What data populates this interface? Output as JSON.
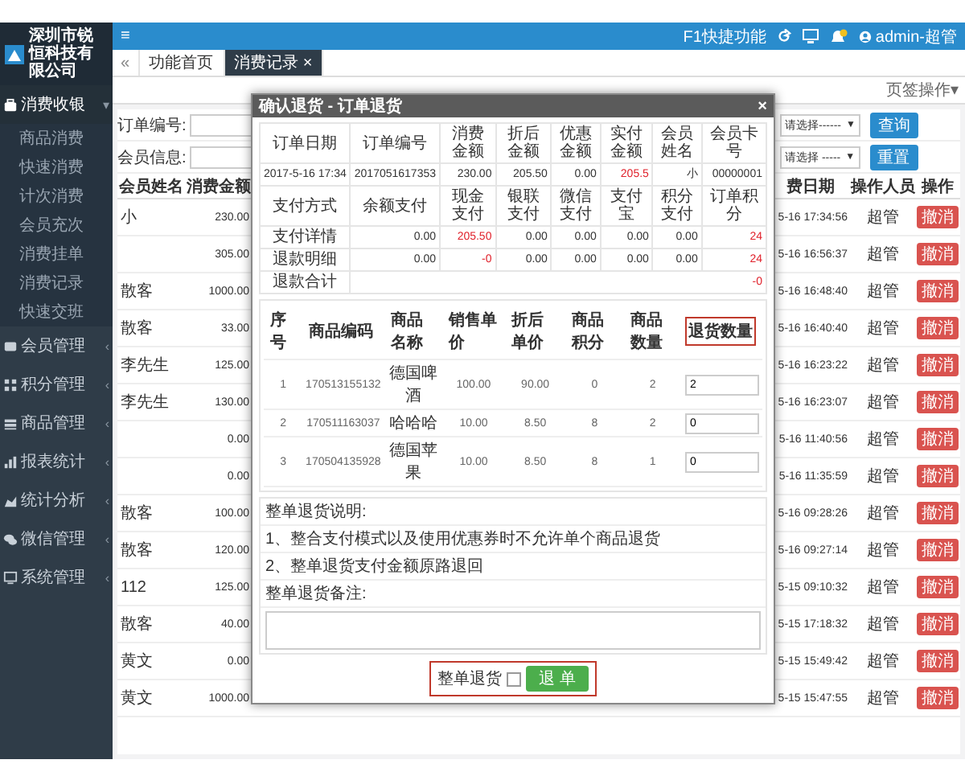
{
  "sidebar": {
    "logo": "深圳市锐恒科技有限公司",
    "menu": [
      {
        "label": "消费收银",
        "expanded": true,
        "children": [
          "商品消费",
          "快速消费",
          "计次消费",
          "会员充次",
          "消费挂单",
          "消费记录",
          "快速交班"
        ]
      },
      {
        "label": "会员管理",
        "expanded": false
      },
      {
        "label": "积分管理",
        "expanded": false
      },
      {
        "label": "商品管理",
        "expanded": false
      },
      {
        "label": "报表统计",
        "expanded": false
      },
      {
        "label": "统计分析",
        "expanded": false
      },
      {
        "label": "微信管理",
        "expanded": false
      },
      {
        "label": "系统管理",
        "expanded": false
      }
    ],
    "collapse": "‹",
    "expanded_mark": "▾"
  },
  "topbar": {
    "menu_toggle": "≡",
    "shortcut": "F1快捷功能",
    "user": "admin-超管"
  },
  "tabs": {
    "back": "«",
    "items": [
      {
        "label": "功能首页",
        "selected": false
      },
      {
        "label": "消费记录",
        "selected": true,
        "close": "×"
      }
    ]
  },
  "tab_menu": {
    "label": "页签操作",
    "caret": "▾"
  },
  "filters": [
    {
      "label": "订单编号:",
      "select": "请选择------",
      "caret": "▼",
      "button": "查询"
    },
    {
      "label": "会员信息:",
      "select": "请选择 -----",
      "caret": "▼",
      "button": "重置"
    }
  ],
  "table": {
    "columns_left": [
      "会员姓名",
      "消费金额"
    ],
    "columns_right": [
      "费日期",
      "操作人员",
      "操作"
    ],
    "rows": [
      {
        "name": "小",
        "amount": "230.00",
        "date": "5-16 17:34:56",
        "operator": "超管",
        "action": "撤消"
      },
      {
        "name": "",
        "amount": "305.00",
        "date": "5-16 16:56:37",
        "operator": "超管",
        "action": "撤消"
      },
      {
        "name": "散客",
        "amount": "1000.00",
        "date": "5-16 16:48:40",
        "operator": "超管",
        "action": "撤消"
      },
      {
        "name": "散客",
        "amount": "33.00",
        "date": "5-16 16:40:40",
        "operator": "超管",
        "action": "撤消"
      },
      {
        "name": "李先生",
        "amount": "125.00",
        "date": "5-16 16:23:22",
        "operator": "超管",
        "action": "撤消"
      },
      {
        "name": "李先生",
        "amount": "130.00",
        "date": "5-16 16:23:07",
        "operator": "超管",
        "action": "撤消"
      },
      {
        "name": "",
        "amount": "0.00",
        "date": "5-16 11:40:56",
        "operator": "超管",
        "action": "撤消"
      },
      {
        "name": "",
        "amount": "0.00",
        "date": "5-16 11:35:59",
        "operator": "超管",
        "action": "撤消"
      },
      {
        "name": "散客",
        "amount": "100.00",
        "date": "5-16 09:28:26",
        "operator": "超管",
        "action": "撤消"
      },
      {
        "name": "散客",
        "amount": "120.00",
        "date": "5-16 09:27:14",
        "operator": "超管",
        "action": "撤消"
      },
      {
        "name": "112",
        "amount": "125.00",
        "date": "5-15 09:10:32",
        "operator": "超管",
        "action": "撤消"
      },
      {
        "name": "散客",
        "amount": "40.00",
        "date": "5-15 17:18:32",
        "operator": "超管",
        "action": "撤消"
      },
      {
        "name": "黄文",
        "amount": "0.00",
        "date": "5-15 15:49:42",
        "operator": "超管",
        "action": "撤消"
      },
      {
        "name": "黄文",
        "amount": "1000.00",
        "date": "5-15 15:47:55",
        "operator": "超管",
        "action": "撤消"
      }
    ]
  },
  "dialog": {
    "title": "确认退货 - 订单退货",
    "close": "×",
    "info_rows": [
      {
        "kind": "head",
        "cells": [
          {
            "text": "订单日期",
            "alert": false
          },
          {
            "text": "订单编号",
            "alert": false
          },
          {
            "text": "消费金额",
            "alert": false
          },
          {
            "text": "折后金额",
            "alert": false
          },
          {
            "text": "优惠金额",
            "alert": false
          },
          {
            "text": "实付金额",
            "alert": false
          },
          {
            "text": "会员姓名",
            "alert": false
          },
          {
            "text": "会员卡号",
            "alert": false
          }
        ]
      },
      {
        "kind": "data",
        "cells": [
          {
            "text": "2017-5-16 17:34",
            "alert": false
          },
          {
            "text": "2017051617353",
            "alert": false
          },
          {
            "text": "230.00",
            "alert": false
          },
          {
            "text": "205.50",
            "alert": false
          },
          {
            "text": "0.00",
            "alert": false
          },
          {
            "text": "205.5",
            "alert": true
          },
          {
            "text": "小",
            "alert": false
          },
          {
            "text": "00000001",
            "alert": false
          }
        ]
      },
      {
        "kind": "head",
        "cells": [
          {
            "text": "支付方式",
            "alert": false
          },
          {
            "text": "余额支付",
            "alert": false
          },
          {
            "text": "现金支付",
            "alert": false
          },
          {
            "text": "银联支付",
            "alert": false
          },
          {
            "text": "微信支付",
            "alert": false
          },
          {
            "text": "支付宝",
            "alert": false
          },
          {
            "text": "积分支付",
            "alert": false
          },
          {
            "text": "订单积分",
            "alert": false
          }
        ]
      },
      {
        "kind": "data",
        "cells": [
          {
            "text": "支付详情",
            "alert": false
          },
          {
            "text": "0.00",
            "alert": false
          },
          {
            "text": "205.50",
            "alert": true
          },
          {
            "text": "0.00",
            "alert": false
          },
          {
            "text": "0.00",
            "alert": false
          },
          {
            "text": "0.00",
            "alert": false
          },
          {
            "text": "0.00",
            "alert": false
          },
          {
            "text": "24",
            "alert": true
          }
        ]
      },
      {
        "kind": "data",
        "cells": [
          {
            "text": "退款明细",
            "alert": false
          },
          {
            "text": "0.00",
            "alert": false
          },
          {
            "text": "-0",
            "alert": true
          },
          {
            "text": "0.00",
            "alert": false
          },
          {
            "text": "0.00",
            "alert": false
          },
          {
            "text": "0.00",
            "alert": false
          },
          {
            "text": "0.00",
            "alert": false
          },
          {
            "text": "24",
            "alert": true
          }
        ]
      },
      {
        "kind": "data",
        "cells": [
          {
            "text": "退款合计",
            "alert": false
          },
          {
            "text": "-0",
            "alert": true
          }
        ]
      }
    ],
    "items": {
      "columns": [
        {
          "label": "序号",
          "highlighted": false
        },
        {
          "label": "商品编码",
          "highlighted": false
        },
        {
          "label": "商品名称",
          "highlighted": false
        },
        {
          "label": "销售单价",
          "highlighted": false
        },
        {
          "label": "折后单价",
          "highlighted": false
        },
        {
          "label": "商品积分",
          "highlighted": false
        },
        {
          "label": "商品数量",
          "highlighted": false
        },
        {
          "label": "退货数量",
          "highlighted": true
        }
      ],
      "rows": [
        {
          "cells": [
            "1",
            "170513155132",
            "德国啤酒",
            "100.00",
            "90.00",
            "0",
            "2"
          ],
          "return_qty": "2"
        },
        {
          "cells": [
            "2",
            "170511163037",
            "哈哈哈",
            "10.00",
            "8.50",
            "8",
            "2"
          ],
          "return_qty": "0"
        },
        {
          "cells": [
            "3",
            "170504135928",
            "德国苹果",
            "10.00",
            "8.50",
            "8",
            "1"
          ],
          "return_qty": "0"
        }
      ]
    },
    "notes": {
      "title": "整单退货说明:",
      "lines": [
        "1、整合支付模式以及使用优惠券时不允许单个商品退货",
        "2、整单退货支付金额原路退回"
      ],
      "remark_label": "整单退货备注:"
    },
    "footer": {
      "checkbox_label": "整单退货",
      "checked": false,
      "button": "退 单",
      "highlighted": true
    }
  }
}
